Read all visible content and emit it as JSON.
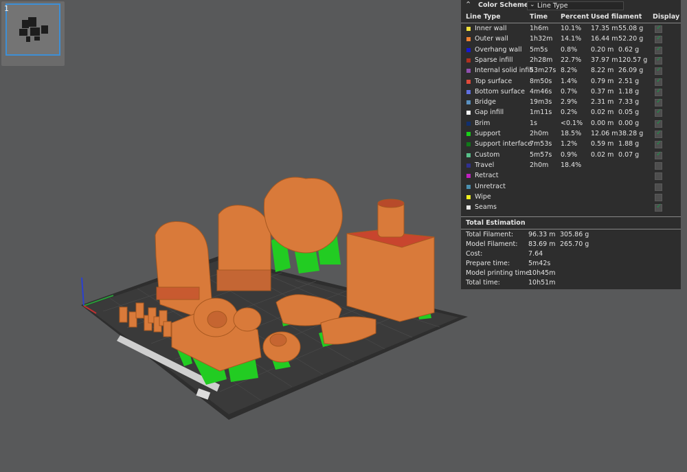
{
  "plate": {
    "number": "1"
  },
  "color_scheme": {
    "title": "Color Scheme",
    "selected": "Line Type",
    "columns": {
      "line_type": "Line Type",
      "time": "Time",
      "percent": "Percent",
      "used_filament": "Used filament",
      "display": "Display"
    },
    "rows": [
      {
        "label": "Inner wall",
        "color": "#f0e03a",
        "time": "1h6m",
        "percent": "10.1%",
        "filament_m": "17.35 m",
        "filament_g": "55.08 g",
        "display": true
      },
      {
        "label": "Outer wall",
        "color": "#f08030",
        "time": "1h32m",
        "percent": "14.1%",
        "filament_m": "16.44 m",
        "filament_g": "52.20 g",
        "display": true
      },
      {
        "label": "Overhang wall",
        "color": "#1818d0",
        "time": "5m5s",
        "percent": "0.8%",
        "filament_m": "0.20 m",
        "filament_g": "0.62 g",
        "display": true
      },
      {
        "label": "Sparse infill",
        "color": "#b03020",
        "time": "2h28m",
        "percent": "22.7%",
        "filament_m": "37.97 m",
        "filament_g": "120.57 g",
        "display": true
      },
      {
        "label": "Internal solid infill",
        "color": "#9050b0",
        "time": "53m27s",
        "percent": "8.2%",
        "filament_m": "8.22 m",
        "filament_g": "26.09 g",
        "display": true
      },
      {
        "label": "Top surface",
        "color": "#e04a3a",
        "time": "8m50s",
        "percent": "1.4%",
        "filament_m": "0.79 m",
        "filament_g": "2.51 g",
        "display": true
      },
      {
        "label": "Bottom surface",
        "color": "#6070e0",
        "time": "4m46s",
        "percent": "0.7%",
        "filament_m": "0.37 m",
        "filament_g": "1.18 g",
        "display": true
      },
      {
        "label": "Bridge",
        "color": "#5a90c0",
        "time": "19m3s",
        "percent": "2.9%",
        "filament_m": "2.31 m",
        "filament_g": "7.33 g",
        "display": true
      },
      {
        "label": "Gap infill",
        "color": "#f4f4f4",
        "time": "1m11s",
        "percent": "0.2%",
        "filament_m": "0.02 m",
        "filament_g": "0.05 g",
        "display": true
      },
      {
        "label": "Brim",
        "color": "#103070",
        "time": "1s",
        "percent": "<0.1%",
        "filament_m": "0.00 m",
        "filament_g": "0.00 g",
        "display": true
      },
      {
        "label": "Support",
        "color": "#18d018",
        "time": "2h0m",
        "percent": "18.5%",
        "filament_m": "12.06 m",
        "filament_g": "38.28 g",
        "display": true
      },
      {
        "label": "Support interface",
        "color": "#107818",
        "time": "7m53s",
        "percent": "1.2%",
        "filament_m": "0.59 m",
        "filament_g": "1.88 g",
        "display": true
      },
      {
        "label": "Custom",
        "color": "#58c08a",
        "time": "5m57s",
        "percent": "0.9%",
        "filament_m": "0.02 m",
        "filament_g": "0.07 g",
        "display": true
      },
      {
        "label": "Travel",
        "color": "#303090",
        "time": "2h0m",
        "percent": "18.4%",
        "filament_m": "",
        "filament_g": "",
        "display": false
      },
      {
        "label": "Retract",
        "color": "#c020c0",
        "time": "",
        "percent": "",
        "filament_m": "",
        "filament_g": "",
        "display": false
      },
      {
        "label": "Unretract",
        "color": "#4a90b0",
        "time": "",
        "percent": "",
        "filament_m": "",
        "filament_g": "",
        "display": false
      },
      {
        "label": "Wipe",
        "color": "#f0f020",
        "time": "",
        "percent": "",
        "filament_m": "",
        "filament_g": "",
        "display": false
      },
      {
        "label": "Seams",
        "color": "#e8e8e8",
        "time": "",
        "percent": "",
        "filament_m": "",
        "filament_g": "",
        "display": true
      }
    ]
  },
  "total_estimation": {
    "title": "Total Estimation",
    "rows": [
      {
        "label": "Total Filament:",
        "v1": "96.33 m",
        "v2": "305.86 g"
      },
      {
        "label": "Model Filament:",
        "v1": "83.69 m",
        "v2": "265.70 g"
      },
      {
        "label": "Cost:",
        "v1": "7.64",
        "v2": ""
      },
      {
        "label": "Prepare time:",
        "v1": "5m42s",
        "v2": ""
      },
      {
        "label": "Model printing time:",
        "v1": "10h45m",
        "v2": ""
      },
      {
        "label": "Total time:",
        "v1": "10h51m",
        "v2": ""
      }
    ]
  },
  "icons": {
    "collapse": "double-chevron-up-icon",
    "dropdown": "chevron-down-icon",
    "checkbox": "check-icon"
  }
}
